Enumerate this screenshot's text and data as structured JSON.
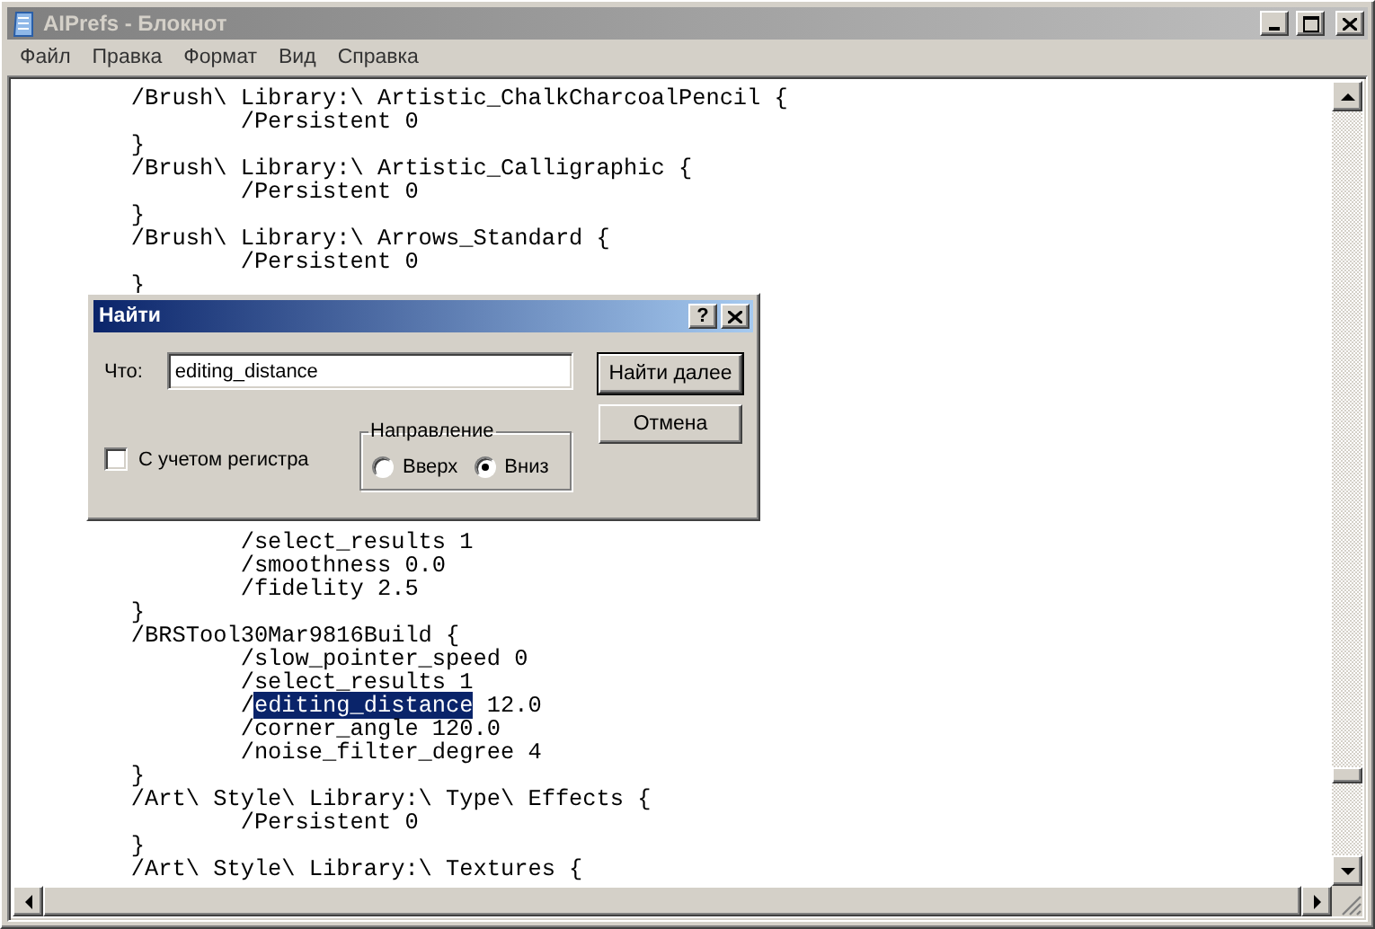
{
  "window": {
    "title": "AIPrefs - Блокнот"
  },
  "menu": [
    {
      "label": "Файл"
    },
    {
      "label": "Правка"
    },
    {
      "label": "Формат"
    },
    {
      "label": "Вид"
    },
    {
      "label": "Справка"
    }
  ],
  "editor": {
    "lines_above": [
      {
        "segments": [
          {
            "text": "\t/Brush\\ Library:\\ Artistic_ChalkCharcoalPencil {",
            "selected": false
          }
        ]
      },
      {
        "segments": [
          {
            "text": "\t\t/Persistent 0",
            "selected": false
          }
        ]
      },
      {
        "segments": [
          {
            "text": "\t}",
            "selected": false
          }
        ]
      },
      {
        "segments": [
          {
            "text": "\t/Brush\\ Library:\\ Artistic_Calligraphic {",
            "selected": false
          }
        ]
      },
      {
        "segments": [
          {
            "text": "\t\t/Persistent 0",
            "selected": false
          }
        ]
      },
      {
        "segments": [
          {
            "text": "\t}",
            "selected": false
          }
        ]
      },
      {
        "segments": [
          {
            "text": "\t/Brush\\ Library:\\ Arrows_Standard {",
            "selected": false
          }
        ]
      },
      {
        "segments": [
          {
            "text": "\t\t/Persistent 0",
            "selected": false
          }
        ]
      },
      {
        "segments": [
          {
            "text": "\t}",
            "selected": false
          }
        ]
      }
    ],
    "lines_below": [
      {
        "segments": [
          {
            "text": "\t\t/select_results 1",
            "selected": false
          }
        ]
      },
      {
        "segments": [
          {
            "text": "\t\t/smoothness 0.0",
            "selected": false
          }
        ]
      },
      {
        "segments": [
          {
            "text": "\t\t/fidelity 2.5",
            "selected": false
          }
        ]
      },
      {
        "segments": [
          {
            "text": "\t}",
            "selected": false
          }
        ]
      },
      {
        "segments": [
          {
            "text": "\t/BRSTool30Mar9816Build {",
            "selected": false
          }
        ]
      },
      {
        "segments": [
          {
            "text": "\t\t/slow_pointer_speed 0",
            "selected": false
          }
        ]
      },
      {
        "segments": [
          {
            "text": "\t\t/select_results 1",
            "selected": false
          }
        ]
      },
      {
        "segments": [
          {
            "text": "\t\t/",
            "selected": false
          },
          {
            "text": "editing_distance",
            "selected": true
          },
          {
            "text": " 12.0",
            "selected": false
          }
        ]
      },
      {
        "segments": [
          {
            "text": "\t\t/corner_angle 120.0",
            "selected": false
          }
        ]
      },
      {
        "segments": [
          {
            "text": "\t\t/noise_filter_degree 4",
            "selected": false
          }
        ]
      },
      {
        "segments": [
          {
            "text": "\t}",
            "selected": false
          }
        ]
      },
      {
        "segments": [
          {
            "text": "\t/Art\\ Style\\ Library:\\ Type\\ Effects {",
            "selected": false
          }
        ]
      },
      {
        "segments": [
          {
            "text": "\t\t/Persistent 0",
            "selected": false
          }
        ]
      },
      {
        "segments": [
          {
            "text": "\t}",
            "selected": false
          }
        ]
      },
      {
        "segments": [
          {
            "text": "\t/Art\\ Style\\ Library:\\ Textures {",
            "selected": false
          }
        ]
      }
    ]
  },
  "find_dialog": {
    "title": "Найти",
    "help_button": "?",
    "what_label": "Что:",
    "what_value": "editing_distance",
    "match_case": {
      "label": "С учетом регистра",
      "checked": false
    },
    "direction": {
      "label": "Направление",
      "options": [
        {
          "label": "Вверх",
          "selected": false
        },
        {
          "label": "Вниз",
          "selected": true
        }
      ]
    },
    "buttons": [
      {
        "label": "Найти далее",
        "default": true
      },
      {
        "label": "Отмена",
        "default": false
      }
    ]
  }
}
